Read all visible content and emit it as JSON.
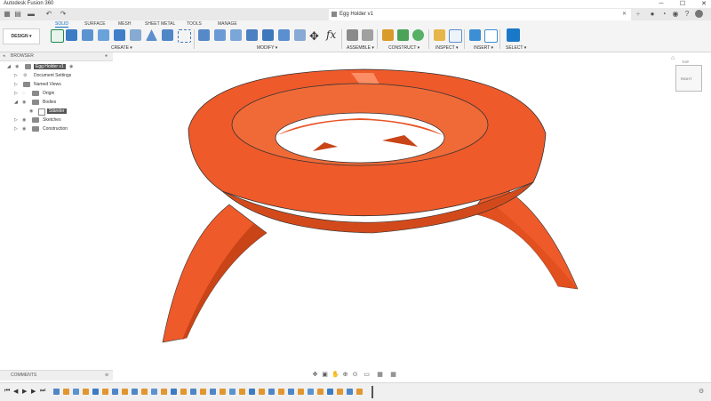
{
  "app": {
    "title": "Autodesk Fusion 360"
  },
  "document": {
    "title": "Egg Holder v1"
  },
  "window_controls": {
    "minimize": "─",
    "maximize": "☐",
    "close": "✕"
  },
  "workspace_tabs": [
    "SOLID",
    "SURFACE",
    "MESH",
    "SHEET METAL",
    "TOOLS",
    "MANAGE"
  ],
  "workspace_switcher": "DESIGN ▾",
  "tool_groups": {
    "create": "CREATE ▾",
    "modify": "MODIFY ▾",
    "assemble": "ASSEMBLE ▾",
    "construct": "CONSTRUCT ▾",
    "inspect": "INSPECT ▾",
    "insert": "INSERT ▾",
    "select": "SELECT ▾"
  },
  "browser": {
    "header": "BROWSER",
    "items": [
      {
        "label": "Egg Holder v1"
      },
      {
        "label": "Document Settings"
      },
      {
        "label": "Named Views"
      },
      {
        "label": "Origin"
      },
      {
        "label": "Bodies"
      },
      {
        "label": "Ständer"
      },
      {
        "label": "Sketches"
      },
      {
        "label": "Construction"
      }
    ]
  },
  "comments": {
    "header": "COMMENTS"
  },
  "viewcube": {
    "face": "RIGHT",
    "top": "TOP"
  },
  "colors": {
    "model": "#ee5a2a",
    "accent": "#1070c0"
  }
}
